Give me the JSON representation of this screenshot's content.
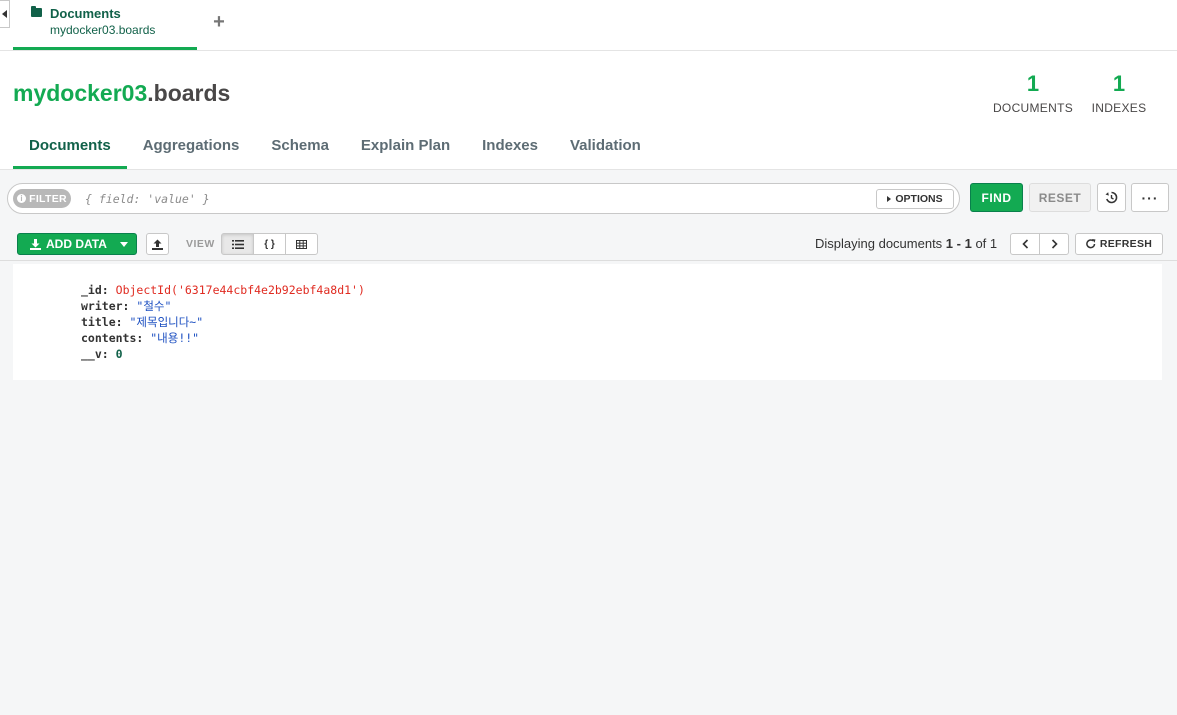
{
  "tab": {
    "title": "Documents",
    "subtitle": "mydocker03.boards"
  },
  "header": {
    "db": "mydocker03",
    "collection": ".boards",
    "stats": {
      "documents_count": "1",
      "documents_label": "DOCUMENTS",
      "indexes_count": "1",
      "indexes_label": "INDEXES"
    }
  },
  "subtabs": [
    "Documents",
    "Aggregations",
    "Schema",
    "Explain Plan",
    "Indexes",
    "Validation"
  ],
  "querybar": {
    "filter_label": "FILTER",
    "filter_placeholder": "{ field: 'value' }",
    "options_label": "OPTIONS",
    "find_label": "FIND",
    "reset_label": "RESET",
    "more_label": "···"
  },
  "toolbar": {
    "add_data_label": "ADD DATA",
    "view_label": "VIEW",
    "displaying_prefix": "Displaying documents ",
    "range_start": "1",
    "range_sep": " - ",
    "range_end": "1",
    "of_text": " of ",
    "total": "1",
    "refresh_label": "REFRESH"
  },
  "document": {
    "fields": [
      {
        "key": "_id",
        "value": "ObjectId('6317e44cbf4e2b92ebf4a8d1')",
        "type": "oid"
      },
      {
        "key": "writer",
        "value": "\"철수\"",
        "type": "str"
      },
      {
        "key": "title",
        "value": "\"제목입니다~\"",
        "type": "str"
      },
      {
        "key": "contents",
        "value": "\"내용!!\"",
        "type": "str"
      },
      {
        "key": "__v",
        "value": "0",
        "type": "num"
      }
    ]
  },
  "colors": {
    "accent": "#13aa52",
    "dark_green": "#116149",
    "oid": "#e02b21",
    "string": "#1c4fc1"
  }
}
